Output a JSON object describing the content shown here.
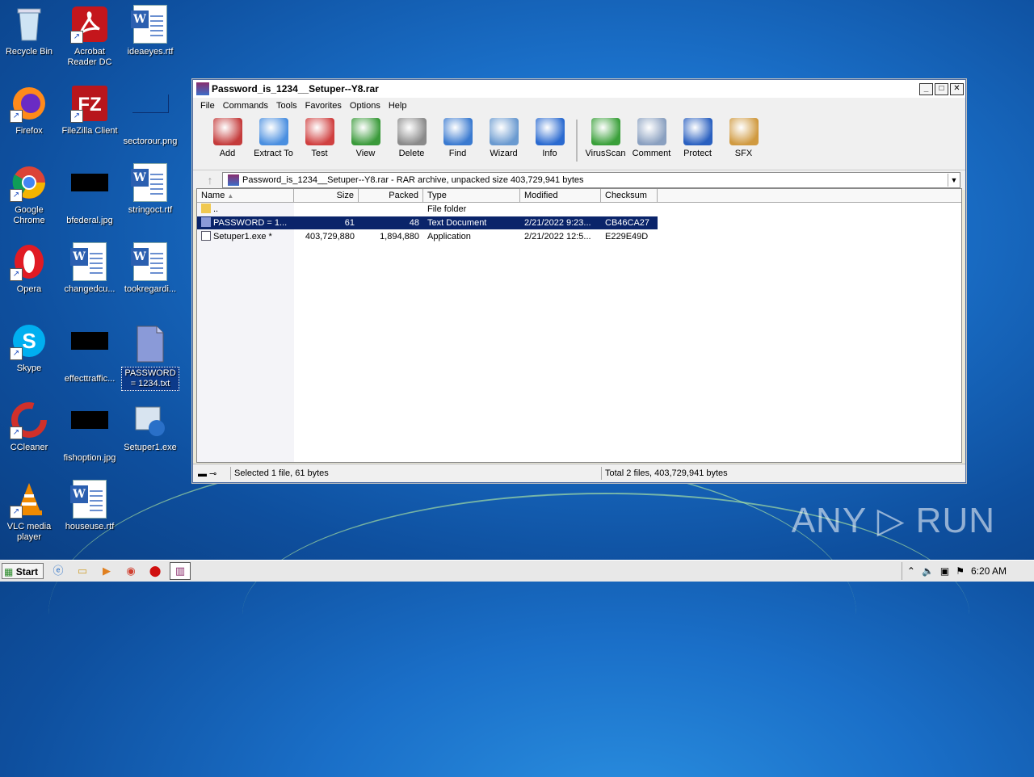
{
  "desktop": {
    "icons": [
      {
        "label": "Recycle Bin"
      },
      {
        "label": "Acrobat Reader DC"
      },
      {
        "label": "ideaeyes.rtf"
      },
      {
        "label": "Firefox"
      },
      {
        "label": "FileZilla Client"
      },
      {
        "label": "sectorour.png"
      },
      {
        "label": "Google Chrome"
      },
      {
        "label": "bfederal.jpg"
      },
      {
        "label": "stringoct.rtf"
      },
      {
        "label": "Opera"
      },
      {
        "label": "changedcu..."
      },
      {
        "label": "tookregardi..."
      },
      {
        "label": "Skype"
      },
      {
        "label": "effecttraffic..."
      },
      {
        "label": "PASSWORD = 1234.txt"
      },
      {
        "label": "CCleaner"
      },
      {
        "label": "fishoption.jpg"
      },
      {
        "label": "Setuper1.exe"
      },
      {
        "label": "VLC media player"
      },
      {
        "label": "houseuse.rtf"
      }
    ]
  },
  "window": {
    "title": "Password_is_1234__Setuper--Y8.rar",
    "controls": {
      "minimize": "_",
      "maximize": "□",
      "close": "✕"
    },
    "menu": [
      "File",
      "Commands",
      "Tools",
      "Favorites",
      "Options",
      "Help"
    ],
    "toolbar": [
      {
        "label": "Add",
        "icon": "add-archive-icon",
        "color": "#c43b3b"
      },
      {
        "label": "Extract To",
        "icon": "extract-folder-icon",
        "color": "#4a8fe0"
      },
      {
        "label": "Test",
        "icon": "test-clipboard-icon",
        "color": "#d04040"
      },
      {
        "label": "View",
        "icon": "view-book-icon",
        "color": "#3a9a3a"
      },
      {
        "label": "Delete",
        "icon": "trash-icon",
        "color": "#8a8a8a"
      },
      {
        "label": "Find",
        "icon": "magnifier-icon",
        "color": "#3a7ad0"
      },
      {
        "label": "Wizard",
        "icon": "wand-icon",
        "color": "#6a9ad0"
      },
      {
        "label": "Info",
        "icon": "info-icon",
        "color": "#2a6ad0"
      },
      {
        "label": "VirusScan",
        "icon": "bug-icon",
        "color": "#3aa03a"
      },
      {
        "label": "Comment",
        "icon": "comment-icon",
        "color": "#8aa0c0"
      },
      {
        "label": "Protect",
        "icon": "shield-icon",
        "color": "#2a60c0"
      },
      {
        "label": "SFX",
        "icon": "sfx-box-icon",
        "color": "#d09a40"
      }
    ],
    "address": "Password_is_1234__Setuper--Y8.rar - RAR archive, unpacked size 403,729,941 bytes",
    "columns": [
      "Name",
      "Size",
      "Packed",
      "Type",
      "Modified",
      "Checksum"
    ],
    "rows": [
      {
        "name": "..",
        "size": "",
        "packed": "",
        "type": "File folder",
        "modified": "",
        "checksum": ""
      },
      {
        "name": "PASSWORD = 1...",
        "size": "61",
        "packed": "48",
        "type": "Text Document",
        "modified": "2/21/2022 9:23...",
        "checksum": "CB46CA27"
      },
      {
        "name": "Setuper1.exe *",
        "size": "403,729,880",
        "packed": "1,894,880",
        "type": "Application",
        "modified": "2/21/2022 12:5...",
        "checksum": "E229E49D"
      }
    ],
    "status_left": "Selected 1 file, 61 bytes",
    "status_right": "Total 2 files, 403,729,941 bytes"
  },
  "taskbar": {
    "start_label": "Start",
    "clock": "6:20 AM"
  },
  "watermark": "ANY ▷ RUN"
}
